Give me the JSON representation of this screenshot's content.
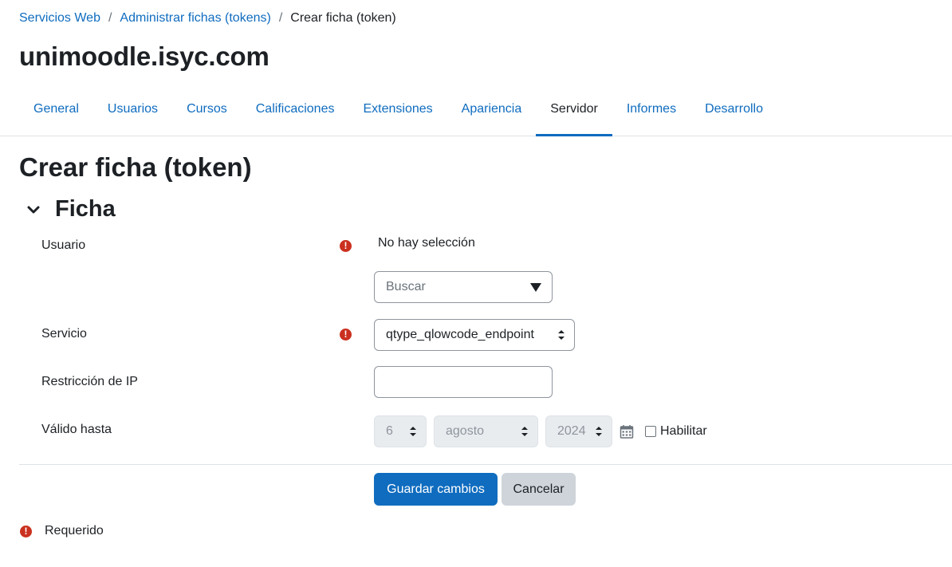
{
  "breadcrumb": {
    "items": [
      "Servicios Web",
      "Administrar fichas (tokens)"
    ],
    "current": "Crear ficha (token)",
    "separator": "/"
  },
  "site_title": "unimoodle.isyc.com",
  "tabs": [
    {
      "label": "General"
    },
    {
      "label": "Usuarios"
    },
    {
      "label": "Cursos"
    },
    {
      "label": "Calificaciones"
    },
    {
      "label": "Extensiones"
    },
    {
      "label": "Apariencia"
    },
    {
      "label": "Servidor",
      "active": true
    },
    {
      "label": "Informes"
    },
    {
      "label": "Desarrollo"
    }
  ],
  "page_heading": "Crear ficha (token)",
  "section": {
    "title": "Ficha",
    "icon": "chevron-down-icon"
  },
  "form": {
    "usuario": {
      "label": "Usuario",
      "required_icon": "!",
      "selection": "No hay selección",
      "search_placeholder": "Buscar"
    },
    "servicio": {
      "label": "Servicio",
      "required_icon": "!",
      "value": "qtype_qlowcode_endpoint"
    },
    "ip": {
      "label": "Restricción de IP",
      "value": ""
    },
    "valido": {
      "label": "Válido hasta",
      "day": "6",
      "month": "agosto",
      "year": "2024",
      "enable_label": "Habilitar",
      "enabled": false
    }
  },
  "buttons": {
    "save": "Guardar cambios",
    "cancel": "Cancelar"
  },
  "legend": {
    "icon": "!",
    "text": "Requerido"
  },
  "colors": {
    "link": "#0f6cbf",
    "primary": "#0f6cbf",
    "required": "#ca3120"
  }
}
